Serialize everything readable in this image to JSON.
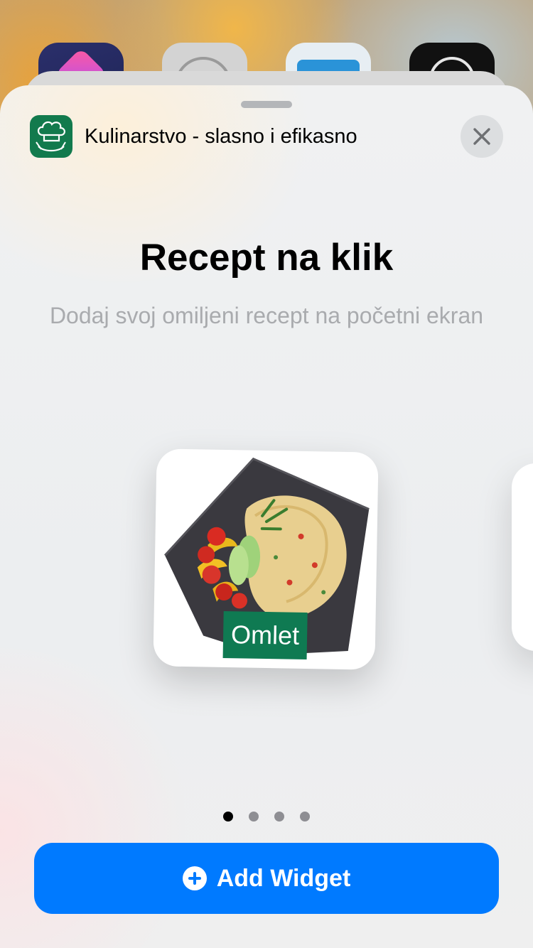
{
  "app": {
    "name": "Kulinarstvo - slasno i efikasno",
    "icon": "chef-hat-icon"
  },
  "widget_gallery": {
    "title": "Recept na klik",
    "subtitle": "Dodaj svoj omiljeni recept na početni ekran",
    "current_widget": {
      "label": "Omlet",
      "image": "omelette-plate-image"
    },
    "page_count": 4,
    "current_page": 1
  },
  "actions": {
    "add_widget_label": "Add Widget",
    "close_icon": "close-icon",
    "add_icon": "plus-circle-icon"
  },
  "colors": {
    "accent": "#007aff",
    "brand_green": "#127a4d"
  }
}
